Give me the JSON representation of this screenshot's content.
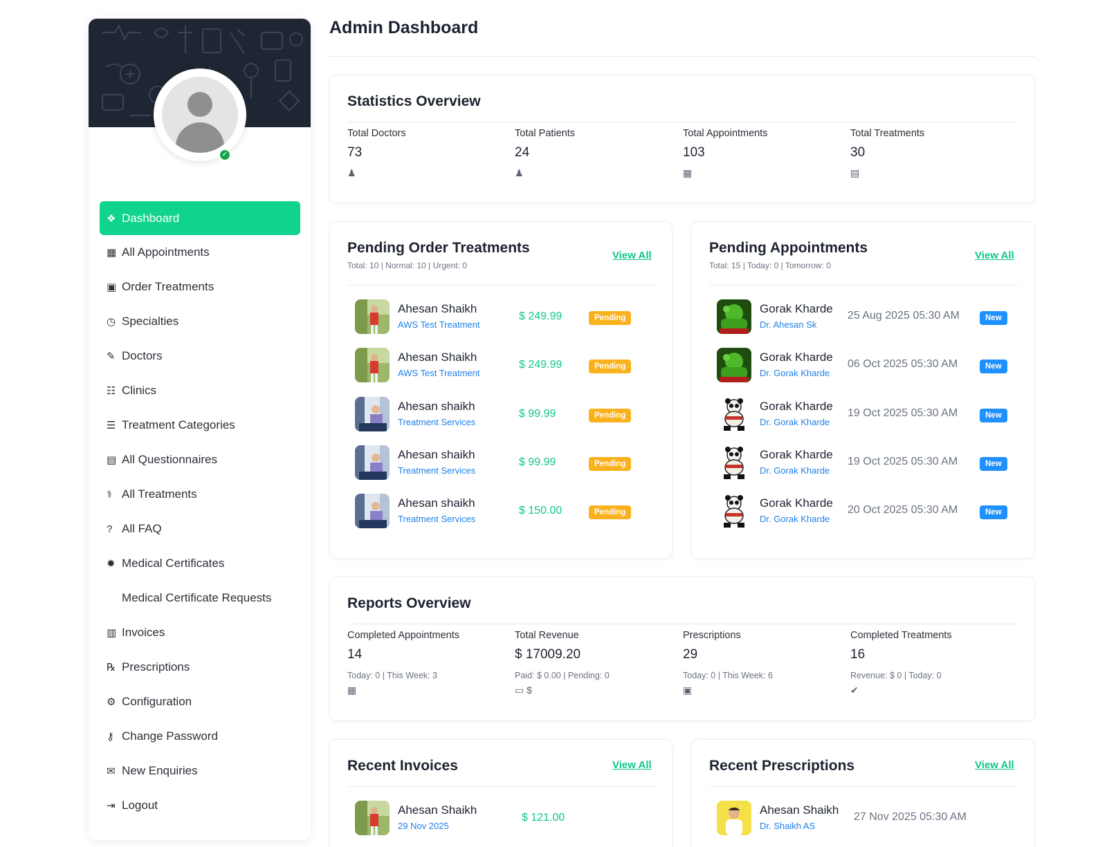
{
  "page_title": "Admin Dashboard",
  "sidebar": {
    "status_icon": "check-icon",
    "items": [
      {
        "label": "Dashboard",
        "icon": "dashboard-icon",
        "glyph": "❖",
        "active": true
      },
      {
        "label": "All Appointments",
        "icon": "calendar-icon",
        "glyph": "▦"
      },
      {
        "label": "Order Treatments",
        "icon": "medicine-bottle-icon",
        "glyph": "▣"
      },
      {
        "label": "Specialties",
        "icon": "clock-icon",
        "glyph": "◷"
      },
      {
        "label": "Doctors",
        "icon": "edit-icon",
        "glyph": "✎"
      },
      {
        "label": "Clinics",
        "icon": "hospital-icon",
        "glyph": "☷"
      },
      {
        "label": "Treatment Categories",
        "icon": "layers-icon",
        "glyph": "☰"
      },
      {
        "label": "All Questionnaires",
        "icon": "clipboard-icon",
        "glyph": "▤"
      },
      {
        "label": "All Treatments",
        "icon": "stethoscope-icon",
        "glyph": "⚕"
      },
      {
        "label": "All FAQ",
        "icon": "question-icon",
        "glyph": "?"
      },
      {
        "label": "Medical Certificates",
        "icon": "certificate-icon",
        "glyph": "✹"
      },
      {
        "label": "Medical Certificate Requests",
        "icon": "",
        "glyph": ""
      },
      {
        "label": "Invoices",
        "icon": "file-icon",
        "glyph": "▥"
      },
      {
        "label": "Prescriptions",
        "icon": "prescription-icon",
        "glyph": "℞"
      },
      {
        "label": "Configuration",
        "icon": "gear-icon",
        "glyph": "⚙"
      },
      {
        "label": "Change Password",
        "icon": "key-icon",
        "glyph": "⚷"
      },
      {
        "label": "New Enquiries",
        "icon": "envelope-icon",
        "glyph": "✉"
      },
      {
        "label": "Logout",
        "icon": "logout-icon",
        "glyph": "⇥"
      }
    ]
  },
  "stats": {
    "title": "Statistics Overview",
    "items": [
      {
        "label": "Total Doctors",
        "value": "73",
        "icon": "doctor-icon"
      },
      {
        "label": "Total Patients",
        "value": "24",
        "icon": "patient-icon"
      },
      {
        "label": "Total Appointments",
        "value": "103",
        "icon": "calendar-icon"
      },
      {
        "label": "Total Treatments",
        "value": "30",
        "icon": "clipboard-icon"
      }
    ]
  },
  "pending_orders": {
    "title": "Pending Order Treatments",
    "meta": "Total: 10 | Normal: 10 | Urgent: 0",
    "view_all": "View All",
    "rows": [
      {
        "name": "Ahesan Shaikh",
        "sub": "AWS Test Treatment",
        "price": "$ 249.99",
        "status": "Pending",
        "thumb": "golf"
      },
      {
        "name": "Ahesan Shaikh",
        "sub": "AWS Test Treatment",
        "price": "$ 249.99",
        "status": "Pending",
        "thumb": "golf"
      },
      {
        "name": "Ahesan shaikh",
        "sub": "Treatment Services",
        "price": "$ 99.99",
        "status": "Pending",
        "thumb": "office"
      },
      {
        "name": "Ahesan shaikh",
        "sub": "Treatment Services",
        "price": "$ 99.99",
        "status": "Pending",
        "thumb": "office"
      },
      {
        "name": "Ahesan shaikh",
        "sub": "Treatment Services",
        "price": "$ 150.00",
        "status": "Pending",
        "thumb": "office"
      }
    ]
  },
  "pending_appointments": {
    "title": "Pending Appointments",
    "meta": "Total: 15 | Today: 0 | Tomorrow: 0",
    "view_all": "View All",
    "rows": [
      {
        "name": "Gorak Kharde",
        "sub": "Dr. Ahesan Sk",
        "date": "25 Aug 2025 05:30 AM",
        "status": "New",
        "thumb": "hulk"
      },
      {
        "name": "Gorak Kharde",
        "sub": "Dr. Gorak Kharde",
        "date": "06 Oct 2025 05:30 AM",
        "status": "New",
        "thumb": "hulk"
      },
      {
        "name": "Gorak Kharde",
        "sub": "Dr. Gorak Kharde",
        "date": "19 Oct 2025 05:30 AM",
        "status": "New",
        "thumb": "panda"
      },
      {
        "name": "Gorak Kharde",
        "sub": "Dr. Gorak Kharde",
        "date": "19 Oct 2025 05:30 AM",
        "status": "New",
        "thumb": "panda"
      },
      {
        "name": "Gorak Kharde",
        "sub": "Dr. Gorak Kharde",
        "date": "20 Oct 2025 05:30 AM",
        "status": "New",
        "thumb": "panda"
      }
    ]
  },
  "reports": {
    "title": "Reports Overview",
    "items": [
      {
        "label": "Completed Appointments",
        "value": "14",
        "meta": "Today: 0 | This Week: 3",
        "icon": "calendar-check-icon",
        "glyph": "▦"
      },
      {
        "label": "Total Revenue",
        "value": "$ 17009.20",
        "meta": "Paid: $ 0.00 | Pending: 0",
        "icon": "money-icon",
        "glyph": "▭ $"
      },
      {
        "label": "Prescriptions",
        "value": "29",
        "meta": "Today: 0 | This Week: 6",
        "icon": "prescription-bottle-icon",
        "glyph": "▣"
      },
      {
        "label": "Completed Treatments",
        "value": "16",
        "meta": "Revenue: $ 0 | Today: 0",
        "icon": "double-check-icon",
        "glyph": "✔"
      }
    ]
  },
  "recent_invoices": {
    "title": "Recent Invoices",
    "view_all": "View All",
    "rows": [
      {
        "name": "Ahesan Shaikh",
        "sub": "29 Nov 2025",
        "price": "$ 121.00",
        "thumb": "golf"
      }
    ]
  },
  "recent_prescriptions": {
    "title": "Recent Prescriptions",
    "view_all": "View All",
    "rows": [
      {
        "name": "Ahesan Shaikh",
        "sub": "Dr. Shaikh AS",
        "date": "27 Nov 2025 05:30 AM",
        "thumb": "yellow"
      }
    ]
  },
  "colors": {
    "accent": "#10d48e",
    "price": "#10c788",
    "link": "#1f7fe8",
    "pending": "#f9b11e",
    "new": "#1e90ff"
  }
}
